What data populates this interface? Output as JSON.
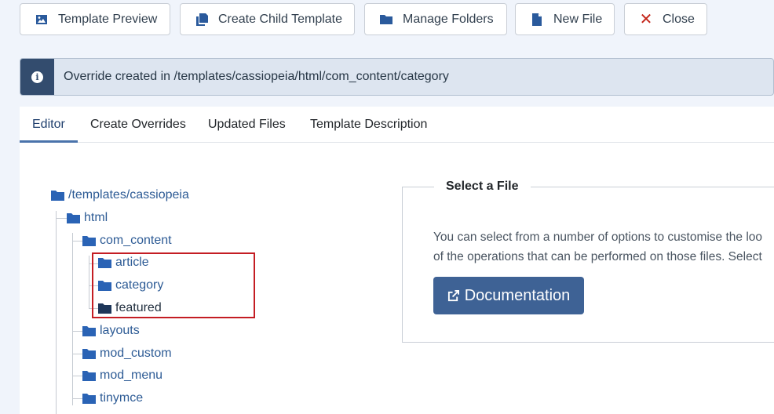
{
  "toolbar": {
    "buttons": [
      {
        "label": "Template Preview",
        "icon": "image-icon"
      },
      {
        "label": "Create Child Template",
        "icon": "copy-icon"
      },
      {
        "label": "Manage Folders",
        "icon": "folder-icon"
      },
      {
        "label": "New File",
        "icon": "file-icon"
      },
      {
        "label": "Close",
        "icon": "close-icon"
      }
    ]
  },
  "alert": {
    "icon": "info-icon",
    "message": "Override created in /templates/cassiopeia/html/com_content/category"
  },
  "tabs": [
    "Editor",
    "Create Overrides",
    "Updated Files",
    "Template Description"
  ],
  "active_tab": "Editor",
  "tree": {
    "root": "/templates/cassiopeia",
    "html": "html",
    "com_content": "com_content",
    "article": "article",
    "category": "category",
    "featured": "featured",
    "layouts": "layouts",
    "mod_custom": "mod_custom",
    "mod_menu": "mod_menu",
    "tinymce": "tinymce"
  },
  "select_file": {
    "legend": "Select a File",
    "line1": "You can select from a number of options to customise the loo",
    "line2": "of the operations that can be performed on those files. Select",
    "doc_button": "Documentation"
  },
  "colors": {
    "accent": "#3e6295",
    "alert_stripe": "#334c6e",
    "folder": "#2a63b5",
    "highlight": "#c41d23"
  }
}
